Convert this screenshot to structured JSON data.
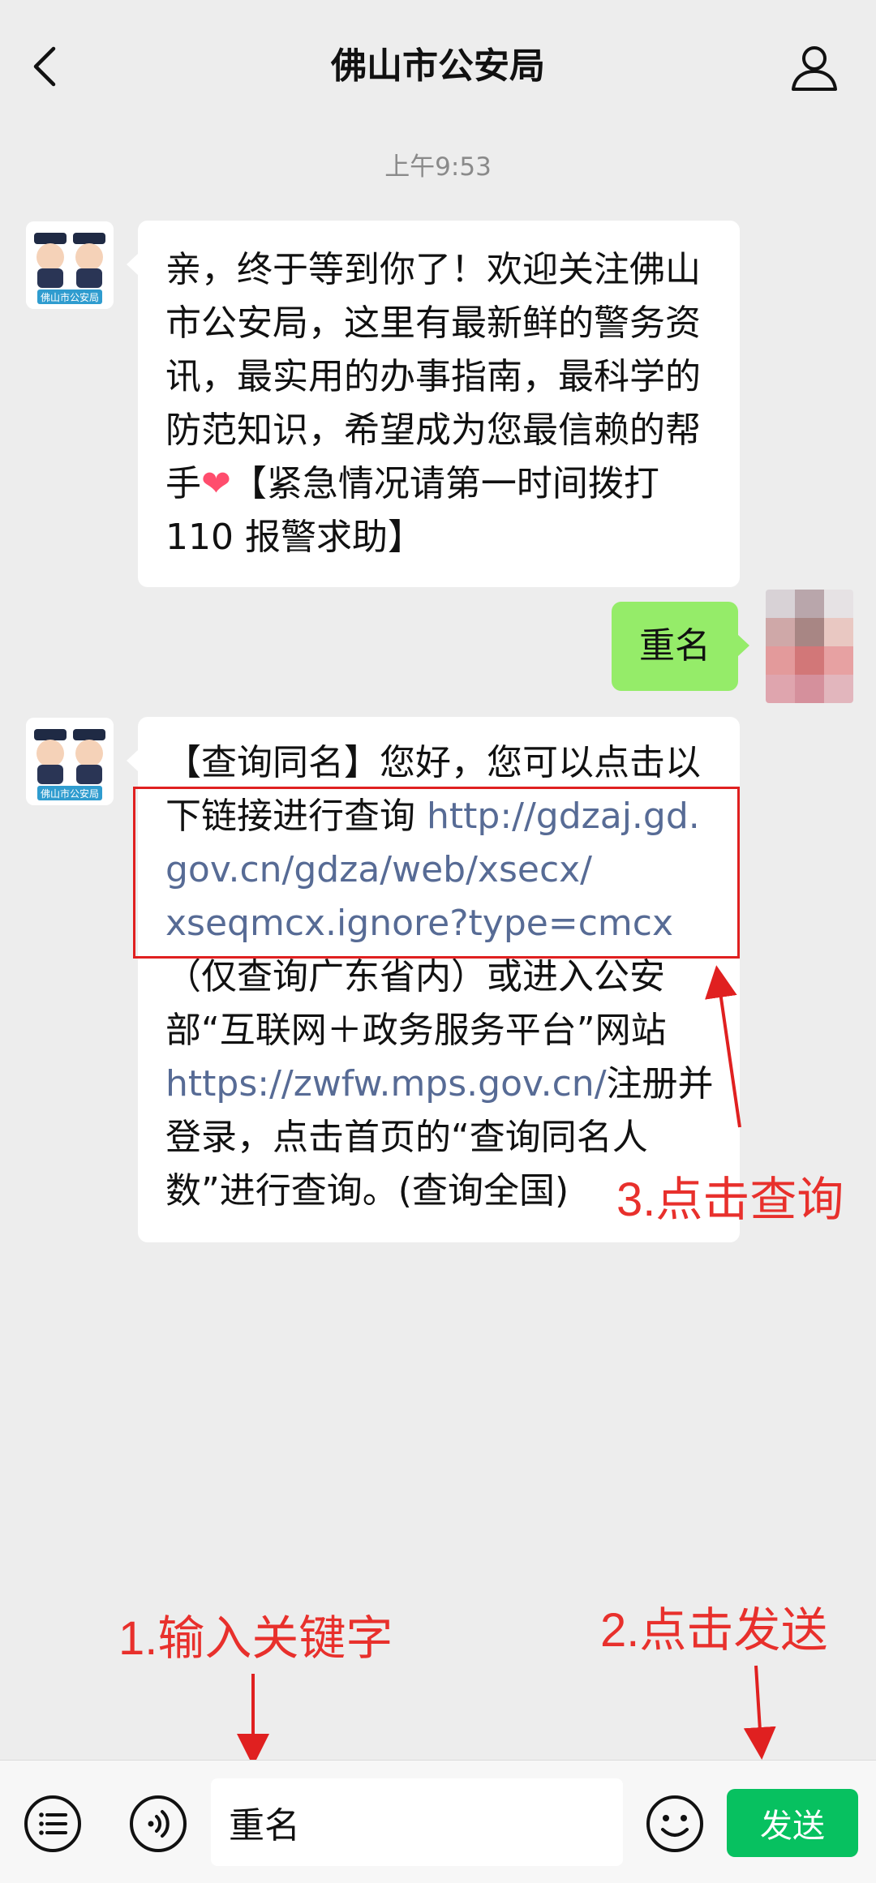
{
  "header": {
    "title": "佛山市公安局",
    "back_icon": "chevron-left-icon",
    "profile_icon": "user-icon"
  },
  "chat": {
    "timestamp": "上午9:53",
    "avatar_badge": "佛山市公安局",
    "messages": [
      {
        "sender": "official",
        "text_part1": "亲，终于等到你了！欢迎关注佛山市公安局，这里有最新鲜的警务资讯，最实用的办事指南，最科学的防范知识，希望成为您最信赖的帮手",
        "emoji": "❤",
        "text_part2": "【紧急情况请第一时间拨打110 报警求助】"
      },
      {
        "sender": "user",
        "text": "重名"
      },
      {
        "sender": "official",
        "prefix": "【查询同名】您好，您可以点击以下链接进行查询",
        "link1_line1": "http://gdzaj.gd.",
        "link1_line2": "gov.cn/gdza/web/xsecx/",
        "link1_line3": "xseqmcx.ignore?type=cmcx",
        "middle": "（仅查询广东省内）或进入公安部“互联网＋政务服务平台”网站",
        "link2": "https://zwfw.mps.gov.cn/",
        "suffix": "注册并登录，点击首页的“查询同名人数”进行查询。(查询全国)"
      }
    ]
  },
  "annotations": {
    "step1": "1.输入关键字",
    "step2": "2.点击发送",
    "step3": "3.点击查询",
    "color": "#e8302c"
  },
  "input_bar": {
    "menu_icon": "list-icon",
    "voice_icon": "voice-icon",
    "emoji_icon": "smiley-icon",
    "input_value": "重名",
    "send_label": "发送",
    "send_color": "#07c160"
  },
  "colors": {
    "background": "#ededed",
    "outgoing_bubble": "#95ec69",
    "link": "#576b95"
  }
}
